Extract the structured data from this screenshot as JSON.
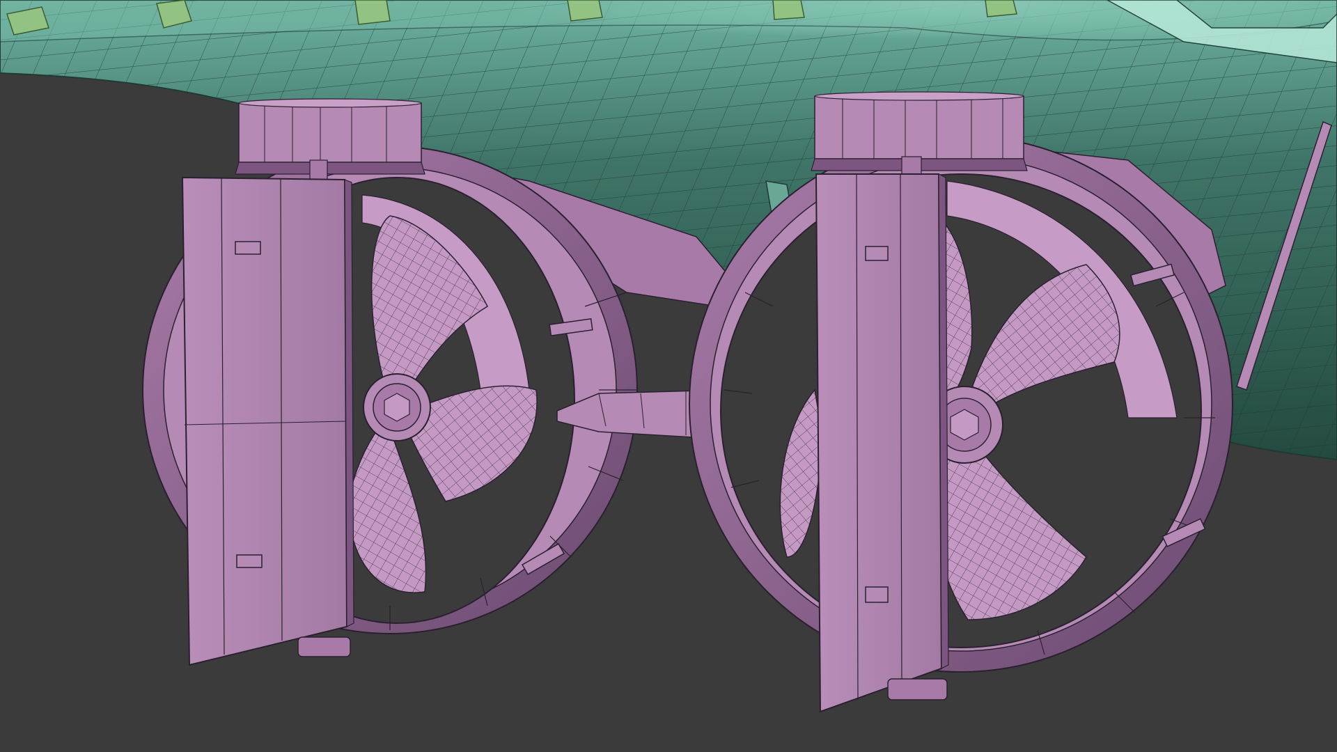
{
  "scene": {
    "subject": "twin-ducted-propellers-with-rudders-wireframe",
    "colors": {
      "background": "#3b3b3b",
      "hull_top": "#5fa393",
      "hull_mid": "#3f7568",
      "hull_dark": "#264a41",
      "hull_strake": "#7fb8a6",
      "blocks": "#93c383",
      "blocks_dark": "#6f9a62",
      "part_light": "#c89cc7",
      "part_mid": "#a87aa8",
      "part_dark": "#7c5680",
      "part_darker": "#5f4062",
      "wire": "#2a2030",
      "hull_wire": "#1e3a33"
    },
    "icons": [
      "hull-mesh",
      "keel-blocks",
      "nozzle",
      "propeller",
      "rudder",
      "shaft",
      "support-strut"
    ]
  }
}
